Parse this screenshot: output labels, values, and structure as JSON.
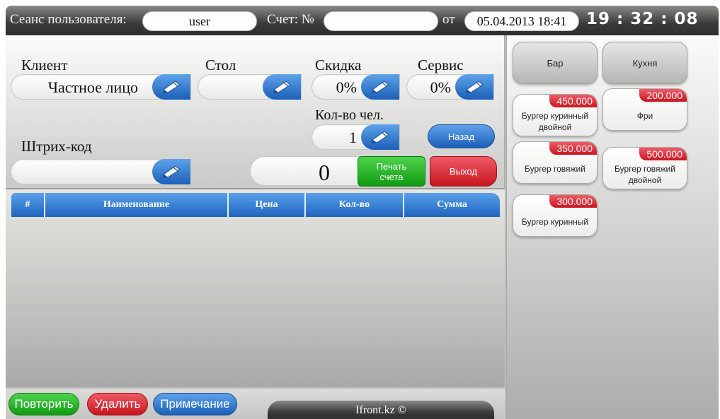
{
  "header": {
    "session_label": "Сеанс пользователя:",
    "user": "user",
    "invoice_label": "Счет: №",
    "invoice_number": "",
    "date_label": "от",
    "datetime": "05.04.2013 18:41",
    "clock": "19 : 32 : 08"
  },
  "form": {
    "client_label": "Клиент",
    "client_value": "Частное лицо",
    "table_label": "Стол",
    "table_value": "",
    "discount_label": "Скидка",
    "discount_value": "0%",
    "service_label": "Сервис",
    "service_value": "0%",
    "people_label": "Кол-во чел.",
    "people_value": "1",
    "barcode_label": "Штрих-код",
    "barcode_value": "",
    "total": "0"
  },
  "buttons": {
    "back": "Назад",
    "print": "Печать счета",
    "exit": "Выход",
    "repeat": "Повторить",
    "delete": "Удалить",
    "note": "Примечание"
  },
  "table": {
    "columns": [
      "#",
      "Наименование",
      "Цена",
      "Кол-во",
      "Сумма"
    ],
    "rows": []
  },
  "menu": {
    "categories": [
      "Бар",
      "Кухня"
    ],
    "items": [
      {
        "name": "Бургер куринный двойной",
        "price": "450.000"
      },
      {
        "name": "Фри",
        "price": "200.000"
      },
      {
        "name": "Бургер говяжий",
        "price": "350.000"
      },
      {
        "name": "Бургер говяжий двойной",
        "price": "500.000"
      },
      {
        "name": "Бургер куринный",
        "price": "300.000"
      }
    ]
  },
  "footer": "Ifront.kz ©",
  "icons": {
    "edit": "pencil-icon"
  },
  "colors": {
    "accent_blue": "#2a73cc",
    "accent_green": "#1aa81a",
    "accent_red": "#d52530",
    "header_dark": "#3a3b39"
  }
}
